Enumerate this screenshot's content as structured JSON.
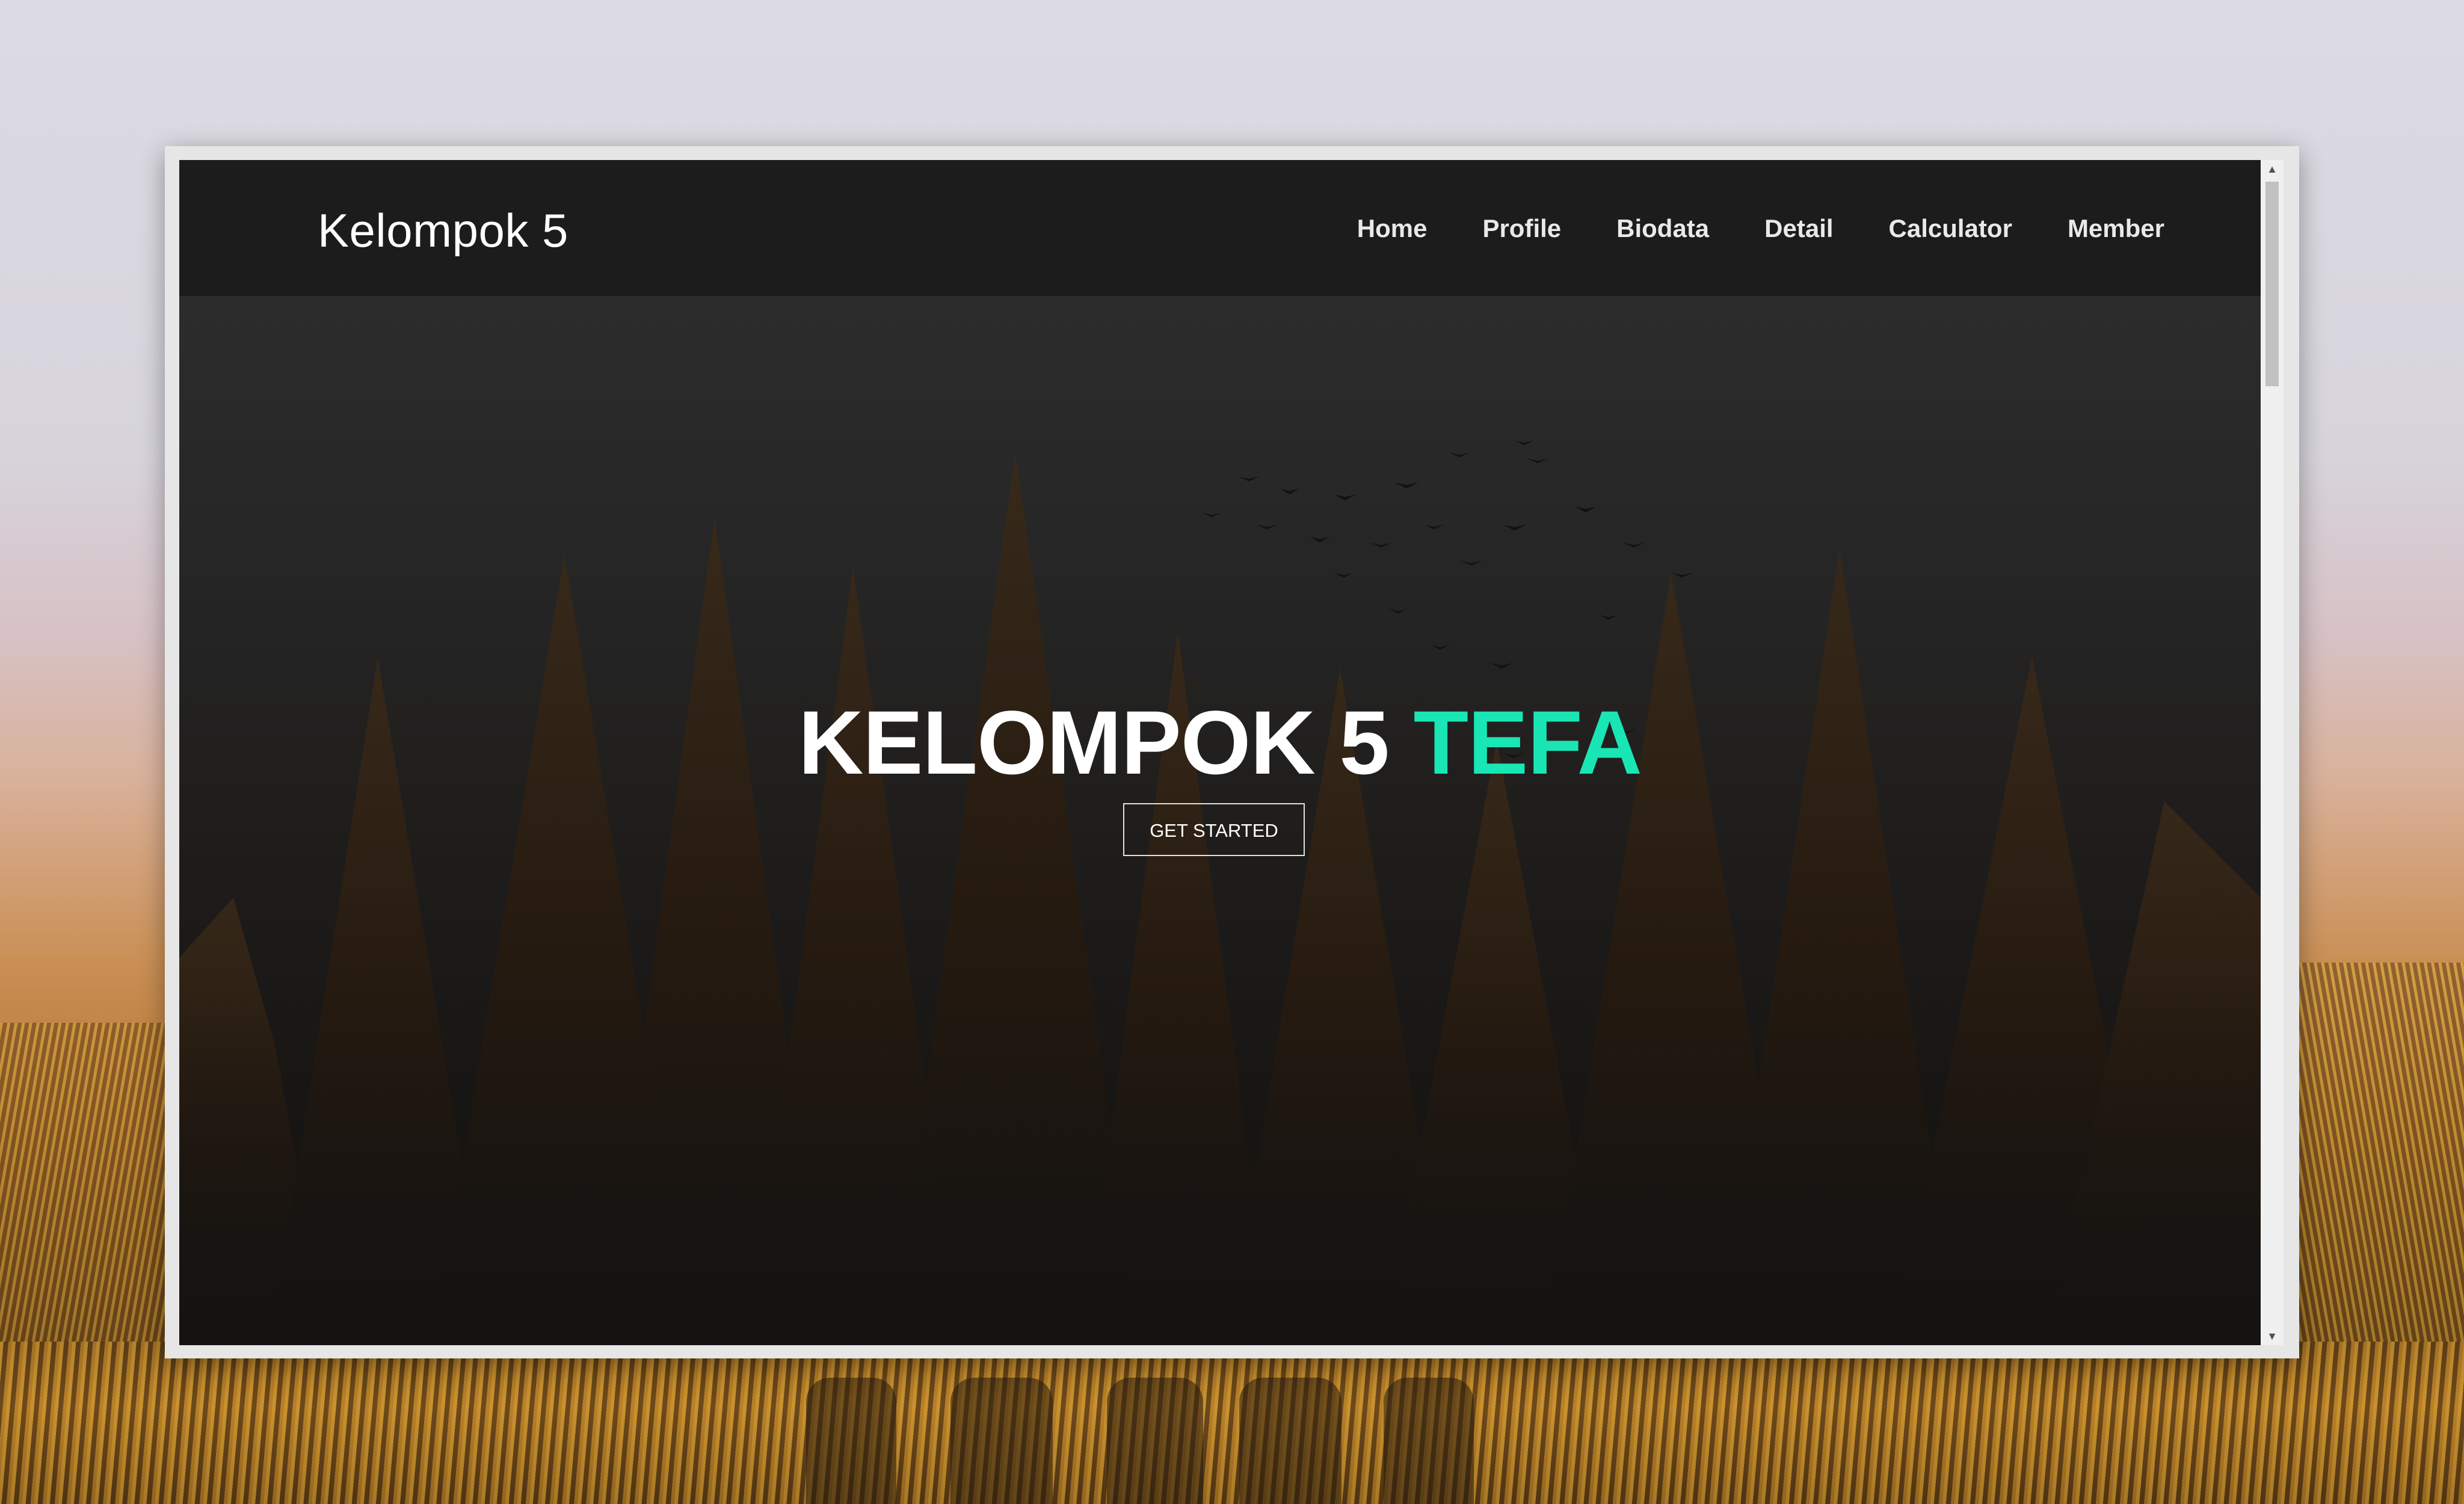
{
  "navbar": {
    "brand": "Kelompok 5",
    "links": [
      {
        "label": "Home"
      },
      {
        "label": "Profile"
      },
      {
        "label": "Biodata"
      },
      {
        "label": "Detail"
      },
      {
        "label": "Calculator"
      },
      {
        "label": "Member"
      }
    ]
  },
  "hero": {
    "title_main": "KELOMPOK 5",
    "title_accent": "TEFA",
    "cta_label": "GET STARTED"
  },
  "colors": {
    "navbar_bg": "#1c1c1c",
    "accent": "#19e6b4",
    "text": "#ffffff"
  },
  "icons": {
    "scroll_up": "scroll-up-arrow-icon",
    "scroll_down": "scroll-down-arrow-icon"
  }
}
